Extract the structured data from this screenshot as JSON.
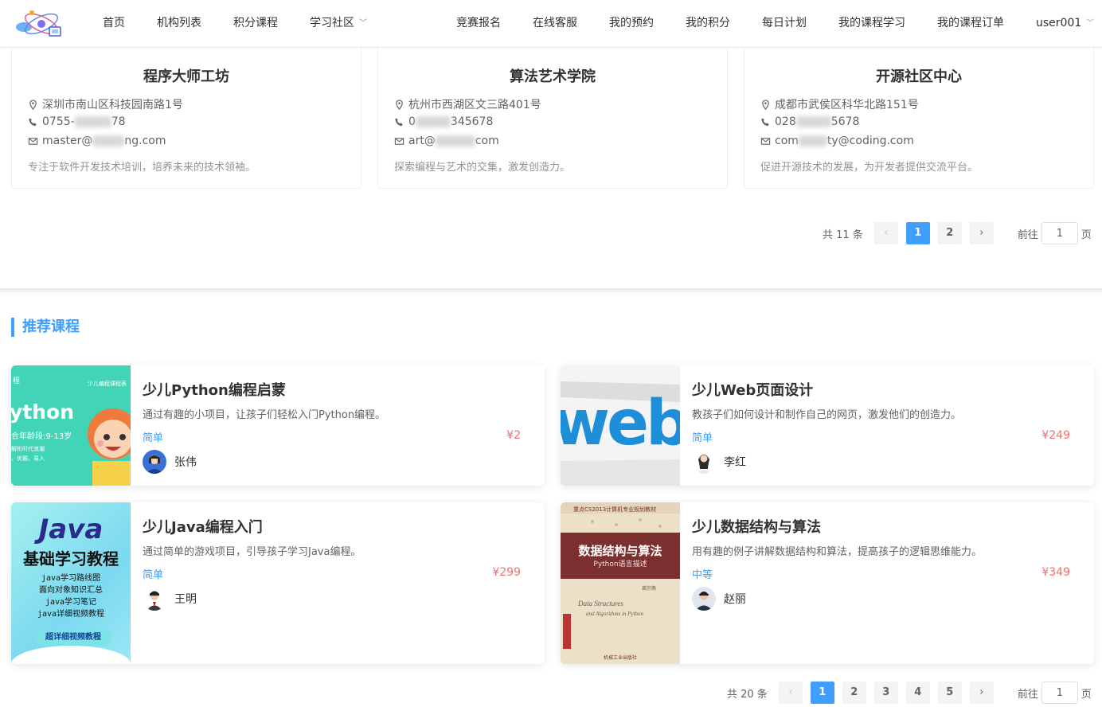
{
  "header": {
    "nav_left": [
      "首页",
      "机构列表",
      "积分课程",
      "学习社区"
    ],
    "nav_right": [
      "竞赛报名",
      "在线客服",
      "我的预约",
      "我的积分",
      "每日计划",
      "我的课程学习",
      "我的课程订单"
    ],
    "user": "user001",
    "dropdown_icon": "chevron-down-icon"
  },
  "institutions": [
    {
      "name": "程序大师工坊",
      "address": "深圳市南山区科技园南路1号",
      "phone_prefix": "0755-",
      "phone_suffix": "78",
      "email_prefix": "master@",
      "email_suffix": "ng.com",
      "desc": "专注于软件开发技术培训，培养未来的技术领袖。"
    },
    {
      "name": "算法艺术学院",
      "address": "杭州市西湖区文三路401号",
      "phone_prefix": "0",
      "phone_suffix": "345678",
      "email_prefix": "art@",
      "email_suffix": "com",
      "desc": "探索编程与艺术的交集，激发创造力。"
    },
    {
      "name": "开源社区中心",
      "address": "成都市武侯区科华北路151号",
      "phone_prefix": "028",
      "phone_suffix": "5678",
      "email_prefix": "com",
      "email_suffix": "ty@coding.com",
      "desc": "促进开源技术的发展，为开发者提供交流平台。"
    }
  ],
  "inst_pager": {
    "total": "共 11 条",
    "pages": [
      "1",
      "2"
    ],
    "current": "1",
    "goto_label": "前往",
    "goto_value": "1",
    "page_label": "页"
  },
  "section_title": "推荐课程",
  "courses": [
    {
      "title": "少儿Python编程启蒙",
      "desc": "通过有趣的小项目，让孩子们轻松入门Python编程。",
      "level": "简单",
      "price": "¥2",
      "teacher": "张伟",
      "thumb": {
        "word": "ython",
        "age": "合年龄段:9-13岁",
        "top_right": "少儿编程课程表",
        "top_left": "程",
        "line1": "解析时代浪潮",
        "line2": "、优雅、易入"
      }
    },
    {
      "title": "少儿Web页面设计",
      "desc": "教孩子们如何设计和制作自己的网页，激发他们的创造力。",
      "level": "简单",
      "price": "¥249",
      "teacher": "李红",
      "thumb": {
        "word": "web"
      }
    },
    {
      "title": "少儿Java编程入门",
      "desc": "通过简单的游戏项目，引导孩子学习Java编程。",
      "level": "简单",
      "price": "¥299",
      "teacher": "王明",
      "thumb": {
        "word": "Java",
        "subtitle": "基础学习教程",
        "lines": [
          "java学习路线图",
          "面向对象知识汇总",
          "java学习笔记",
          "java详细视频教程"
        ],
        "badge": "超详细视频教程"
      }
    },
    {
      "title": "少儿数据结构与算法",
      "desc": "用有趣的例子讲解数据结构和算法，提高孩子的逻辑思维能力。",
      "level": "中等",
      "price": "¥349",
      "teacher": "赵丽",
      "thumb": {
        "banner": "重点CS2013计算机专业规划教材",
        "title": "数据结构与算法",
        "subtitle": "Python语言描述",
        "en1": "Data Structures",
        "en2": "and Algorithms in Python",
        "author": "裘宗燕",
        "publisher": "机械工业出版社"
      }
    }
  ],
  "course_pager": {
    "total": "共 20 条",
    "pages": [
      "1",
      "2",
      "3",
      "4",
      "5"
    ],
    "current": "1",
    "goto_label": "前往",
    "goto_value": "1",
    "page_label": "页"
  }
}
